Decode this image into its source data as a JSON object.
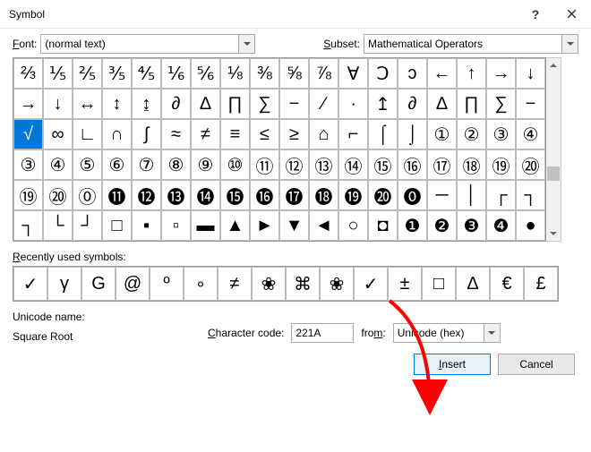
{
  "title": "Symbol",
  "titlebar": {
    "help": "?",
    "close": "×"
  },
  "font": {
    "label": "Font:",
    "value": "(normal text)"
  },
  "subset": {
    "label": "Subset:",
    "value": "Mathematical Operators"
  },
  "grid": [
    [
      "⅔",
      "⅕",
      "⅖",
      "⅗",
      "⅘",
      "⅙",
      "⅚",
      "⅛",
      "⅜",
      "⅝",
      "⅞",
      "Ɐ",
      "Ↄ",
      "ↄ",
      "←",
      "↑",
      "→",
      "↓"
    ],
    [
      "→",
      "↓",
      "↔",
      "↕",
      "↨",
      "∂",
      "∆",
      "∏",
      "∑",
      "−",
      "∕",
      "∙",
      "↥",
      "∂",
      "∆",
      "∏",
      "∑",
      "−"
    ],
    [
      "√",
      "∞",
      "∟",
      "∩",
      "∫",
      "≈",
      "≠",
      "≡",
      "≤",
      "≥",
      "⌂",
      "⌐",
      "⌠",
      "⌡",
      "①",
      "②",
      "③",
      "④"
    ],
    [
      "③",
      "④",
      "⑤",
      "⑥",
      "⑦",
      "⑧",
      "⑨",
      "⑩",
      "⑪",
      "⑫",
      "⑬",
      "⑭",
      "⑮",
      "⑯",
      "⑰",
      "⑱",
      "⑲",
      "⑳"
    ],
    [
      "⑲",
      "⑳",
      "⓪",
      "⓫",
      "⓬",
      "⓭",
      "⓮",
      "⓯",
      "⓰",
      "⓱",
      "⓲",
      "⓳",
      "⓴",
      "⓿",
      "─",
      "│",
      "┌",
      "┐"
    ],
    [
      "┐",
      "└",
      "┘",
      "□",
      "▪",
      "▫",
      "▬",
      "▲",
      "►",
      "▼",
      "◄",
      "○",
      "◘",
      "❶",
      "❷",
      "❸",
      "❹",
      "●"
    ]
  ],
  "grid_selected": {
    "row": 2,
    "col": 0
  },
  "recent": {
    "label": "Recently used symbols:"
  },
  "recent_items": [
    "✓",
    "γ",
    "G",
    "@",
    "º",
    "∘",
    "≠",
    "❀",
    "⌘",
    "❀",
    "✓",
    "±",
    "□",
    "∆",
    "€",
    "£"
  ],
  "unicode": {
    "label": "Unicode name:",
    "value": "Square Root"
  },
  "code": {
    "label": "Character code:",
    "value": "221A"
  },
  "from": {
    "label": "from:",
    "value": "Unicode (hex)"
  },
  "buttons": {
    "insert": "Insert",
    "cancel": "Cancel"
  }
}
